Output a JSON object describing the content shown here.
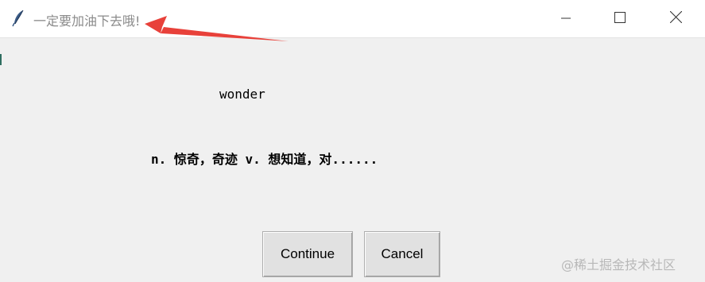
{
  "window": {
    "title": "一定要加油下去哦!",
    "icon": "feather-icon",
    "controls": {
      "minimize_icon": "minimize-icon",
      "maximize_icon": "maximize-icon",
      "close_icon": "close-icon"
    }
  },
  "content": {
    "word": "wonder",
    "meaning": "n. 惊奇，奇迹 v. 想知道，对......"
  },
  "buttons": {
    "continue_label": "Continue",
    "cancel_label": "Cancel"
  },
  "watermark": "@稀土掘金技术社区",
  "colors": {
    "annotation_arrow": "#e8413a",
    "titlebar_bg": "#ffffff",
    "window_bg": "#f0f0f0",
    "title_text": "#8a8a8a"
  }
}
